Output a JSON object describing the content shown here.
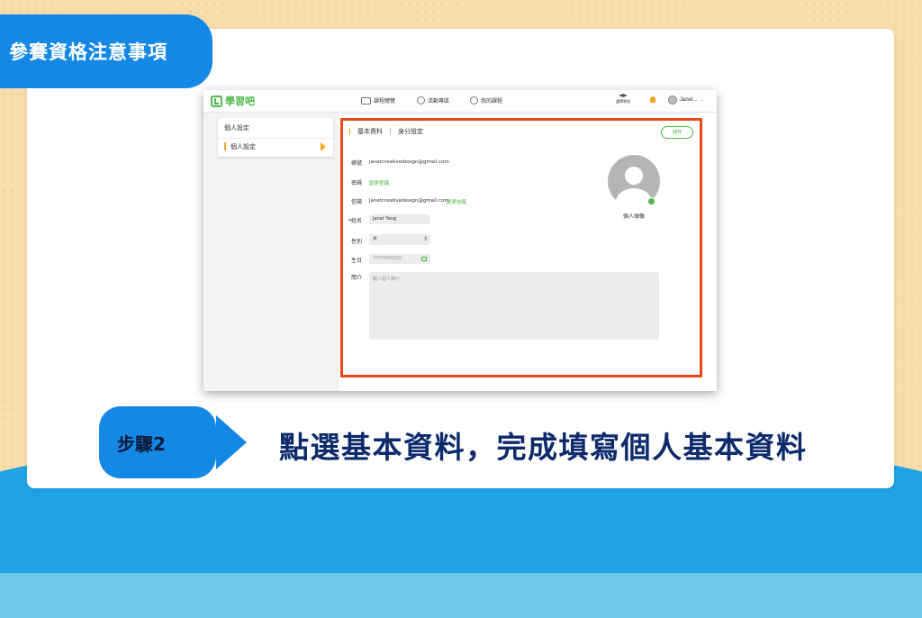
{
  "slide_title": "參賽資格注意事項",
  "app": {
    "logo_text": "學習吧",
    "nav": [
      {
        "label": "課程總覽"
      },
      {
        "label": "活動專區"
      },
      {
        "label": "我的課程"
      }
    ],
    "cap_label": "選擇學習",
    "user_name": "Janet...",
    "sidebar": {
      "heading": "個人設定",
      "items": [
        {
          "label": "個人設定",
          "active": true
        }
      ]
    },
    "tabs": [
      {
        "label": "基本資料",
        "active": true
      },
      {
        "label": "身分設定",
        "active": false
      }
    ],
    "save_label": "儲存",
    "form": {
      "account_label": "帳號",
      "account_value": "janetcreativedesign@gmail.com",
      "password_label": "密碼",
      "password_link": "變更密碼",
      "email_label": "信箱",
      "email_value": "janetcreativedesign@gmail.com",
      "email_link": "變更信箱",
      "name_label": "*姓名",
      "name_value": "Janet Yang",
      "gender_label": "性別",
      "gender_value": "女",
      "birthday_label": "生日",
      "birthday_placeholder": "YYYY/MM/DD",
      "bio_label": "簡介",
      "bio_placeholder": "輸入個人簡介"
    },
    "avatar_label": "個人頭像"
  },
  "step": {
    "label": "步驟2",
    "caption": "點選基本資料，完成填寫個人基本資料"
  },
  "colors": {
    "accent_blue": "#1588e6",
    "highlight_red": "#e84a1c",
    "brand_green": "#4db848",
    "caption_navy": "#0d2b6b"
  }
}
